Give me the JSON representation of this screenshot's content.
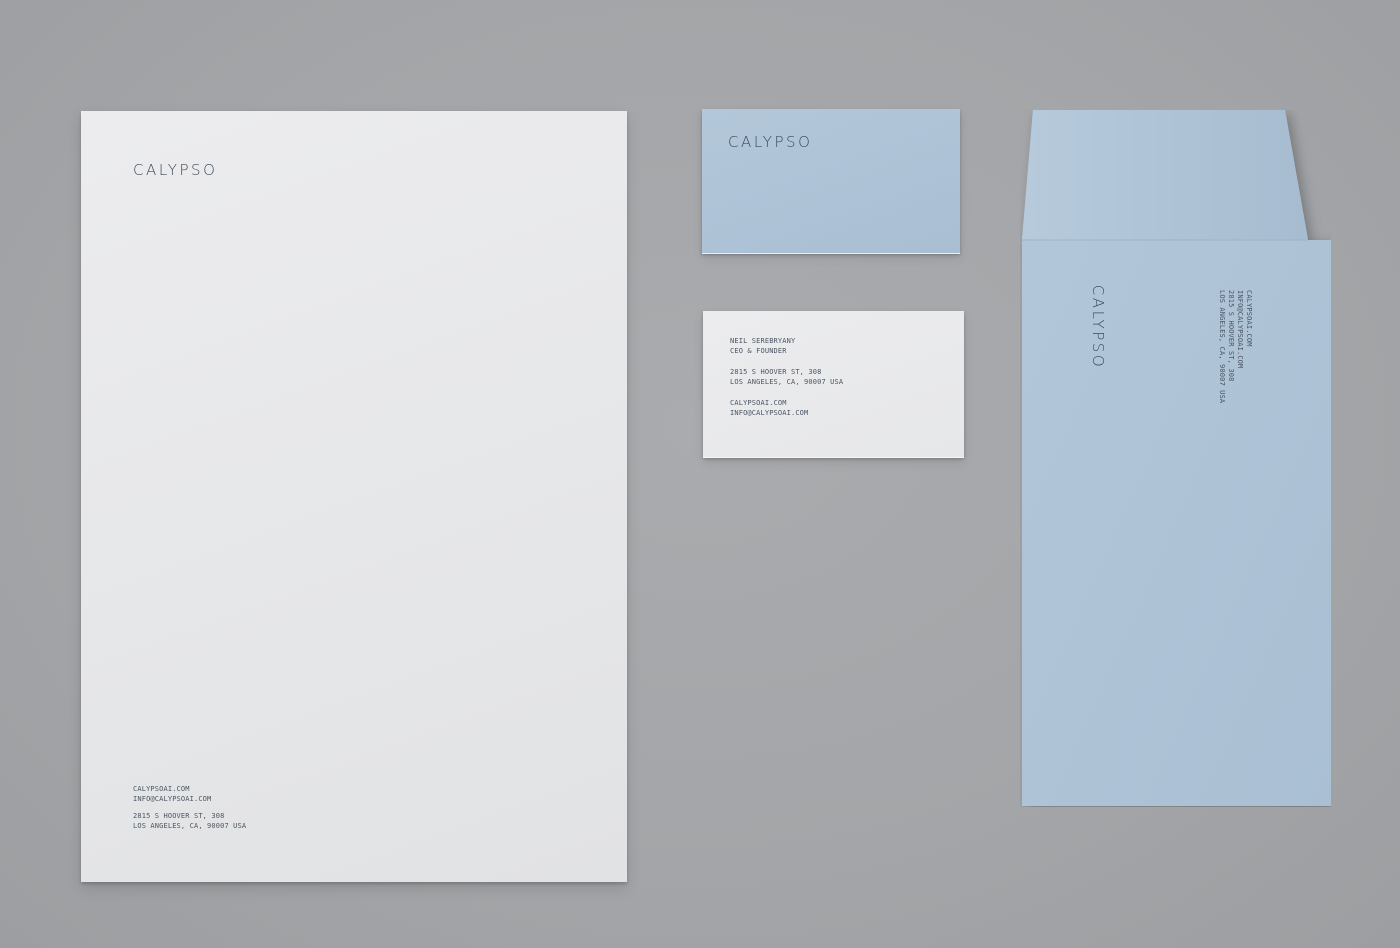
{
  "brand": {
    "name": "CALYPSO"
  },
  "letterhead": {
    "footer": {
      "website": "CALYPSOAI.COM",
      "email": "INFO@CALYPSOAI.COM",
      "address_line1": "2815 S HOOVER ST, 308",
      "address_line2": "LOS ANGELES, CA, 90007 USA"
    }
  },
  "business_card": {
    "front_logo": "CALYPSO",
    "back": {
      "name": "NEIL SEREBRYANY",
      "title": "CEO & FOUNDER",
      "address_line1": "2815 S HOOVER ST, 308",
      "address_line2": "LOS ANGELES, CA, 90007 USA",
      "website": "CALYPSOAI.COM",
      "email": "INFO@CALYPSOAI.COM"
    }
  },
  "envelope": {
    "logo": "CALYPSO",
    "website": "CALYPSOAI.COM",
    "email": "INFO@CALYPSOAI.COM",
    "address_line1": "2815 S HOOVER ST, 308",
    "address_line2": "LOS ANGELES, CA, 90007 USA"
  },
  "colors": {
    "background": "#a5a7aa",
    "paper_white": "#e7e8ea",
    "paper_blue": "#afc4d8",
    "ink": "#3d4a57"
  }
}
